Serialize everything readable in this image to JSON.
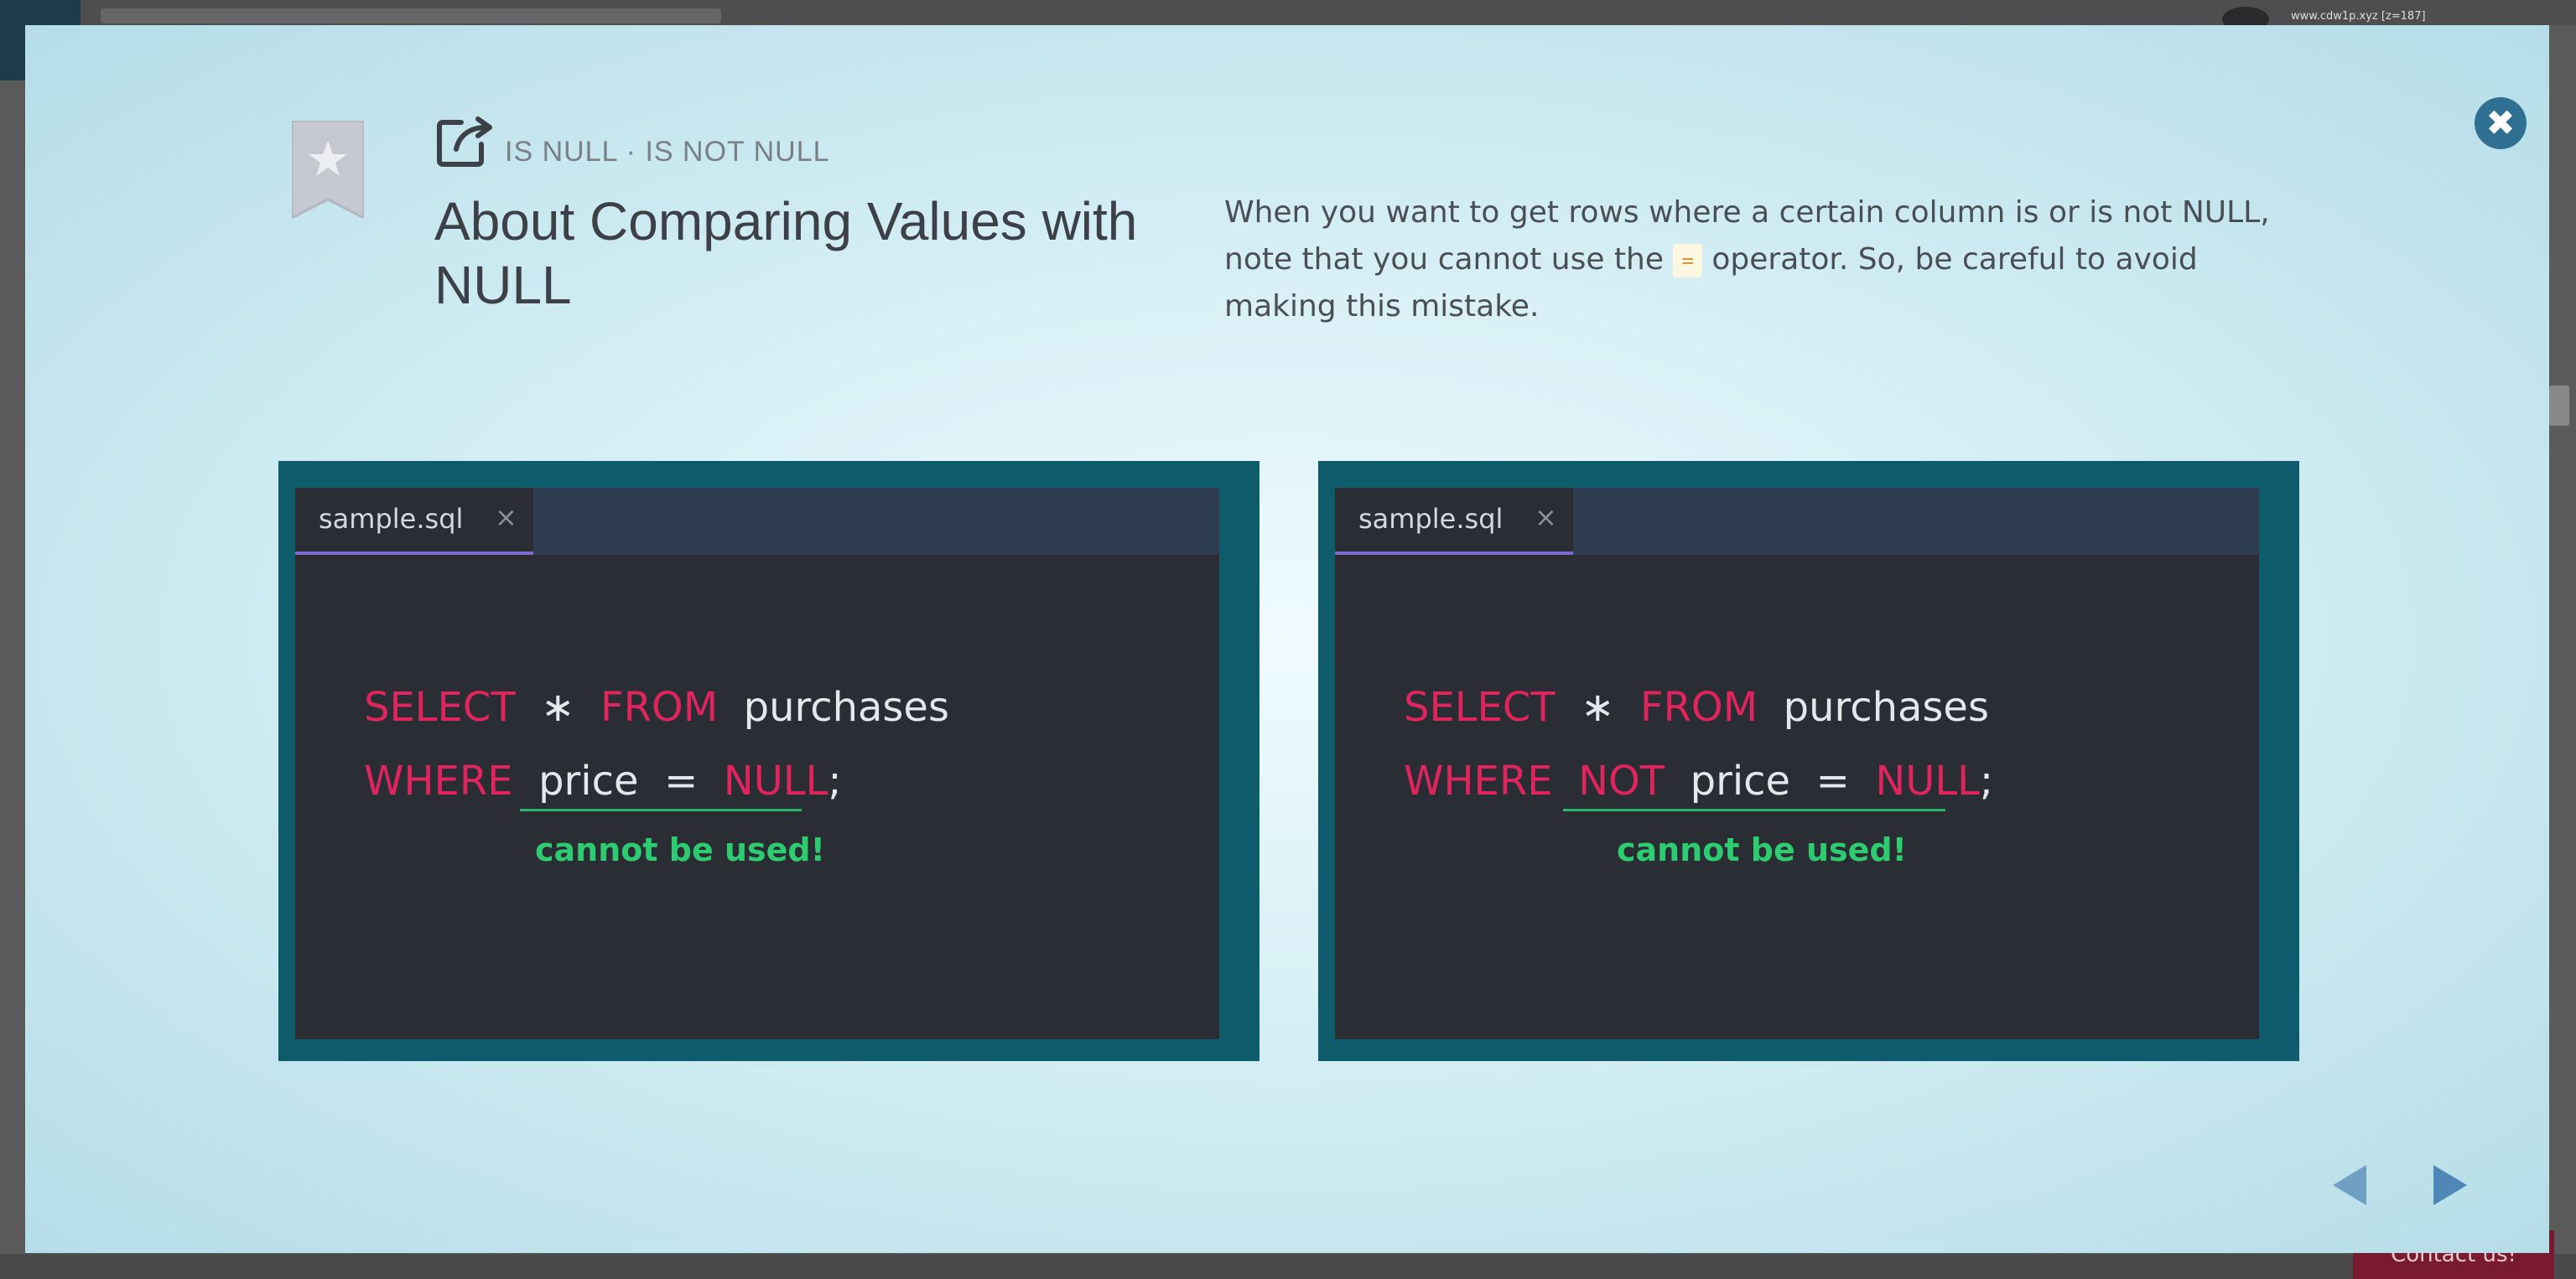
{
  "modal": {
    "subtitle": "IS NULL · IS NOT NULL",
    "title": "About Comparing Values with NULL",
    "description_part1": "When you want to get rows where a certain column is or is not NULL, note that you cannot use the",
    "description_code": "=",
    "description_part2": "operator. So, be careful to avoid making this mistake.",
    "close_label": "✖"
  },
  "panels": [
    {
      "tab_label": "sample.sql",
      "tab_close": "×",
      "line1": {
        "k1": "SELECT",
        "star": "∗",
        "k2": "FROM",
        "table": "purchases"
      },
      "line2": {
        "k1": "WHERE",
        "col": "price",
        "op": "=",
        "k2": "NULL",
        "end": ";"
      },
      "warning": "cannot be used!"
    },
    {
      "tab_label": "sample.sql",
      "tab_close": "×",
      "line1": {
        "k1": "SELECT",
        "star": "∗",
        "k2": "FROM",
        "table": "purchases"
      },
      "line2": {
        "k1": "WHERE",
        "not": "NOT",
        "col": "price",
        "op": "=",
        "k2": "NULL",
        "end": ";"
      },
      "warning": "cannot be used!"
    }
  ],
  "background": {
    "contact_label": "Contact us!",
    "url_text": "www.cdw1p.xyz [z=187]"
  },
  "colors": {
    "accent": "#2e6f92",
    "keyword": "#e0245e",
    "warning": "#2ecc71",
    "panel_border": "#0e5b6b"
  },
  "icons": [
    "bookmark-star-icon",
    "external-link-icon",
    "close-icon",
    "prev-arrow-icon",
    "next-arrow-icon"
  ]
}
